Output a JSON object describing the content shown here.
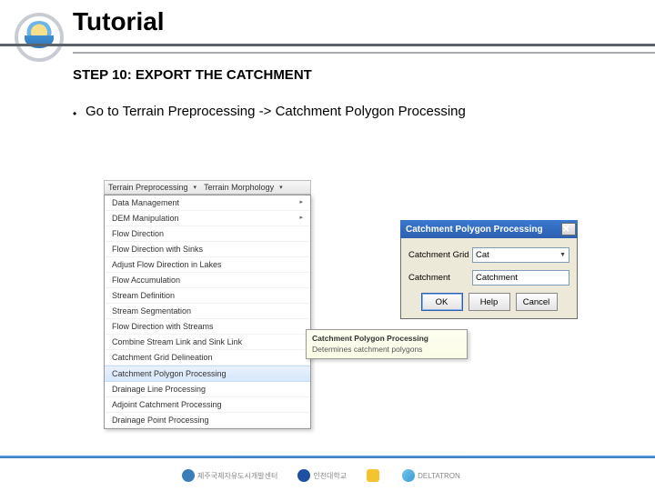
{
  "header": {
    "title": "Tutorial"
  },
  "step": {
    "label": "STEP 10: EXPORT THE CATCHMENT"
  },
  "bullet": {
    "glyph": "•",
    "text": "Go to Terrain Preprocessing -> Catchment Polygon Processing"
  },
  "menu": {
    "toolbar": {
      "active": "Terrain Preprocessing",
      "next": "Terrain Morphology"
    },
    "items": [
      "Data Management",
      "DEM Manipulation",
      "Flow Direction",
      "Flow Direction with Sinks",
      "Adjust Flow Direction in Lakes",
      "Flow Accumulation",
      "Stream Definition",
      "Stream Segmentation",
      "Flow Direction with Streams",
      "Combine Stream Link and Sink Link",
      "Catchment Grid Delineation",
      "Catchment Polygon Processing",
      "Drainage Line Processing",
      "Adjoint Catchment Processing",
      "Drainage Point Processing"
    ],
    "submenu_header": "Terrain Preprocessing",
    "flyout": {
      "title": "Catchment Polygon Processing",
      "desc": "Determines catchment polygons"
    }
  },
  "dialog": {
    "title": "Catchment Polygon Processing",
    "rows": [
      {
        "label": "Catchment Grid",
        "value": "Cat"
      },
      {
        "label": "Catchment",
        "value": "Catchment"
      }
    ],
    "buttons": {
      "ok": "OK",
      "help": "Help",
      "cancel": "Cancel"
    }
  },
  "footer": {
    "org1": "제주국제자유도시개발센터",
    "org2": "인천대학교",
    "org3": "",
    "org4": "DELTATRON"
  }
}
